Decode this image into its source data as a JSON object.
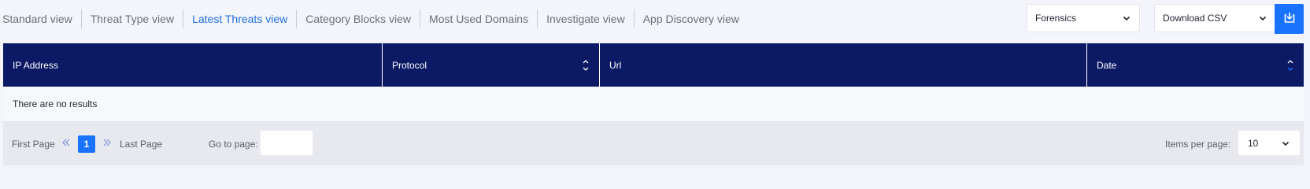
{
  "tabs": [
    {
      "label": "Standard view",
      "active": false
    },
    {
      "label": "Threat Type view",
      "active": false
    },
    {
      "label": "Latest Threats view",
      "active": true
    },
    {
      "label": "Category Blocks view",
      "active": false
    },
    {
      "label": "Most Used Domains",
      "active": false
    },
    {
      "label": "Investigate view",
      "active": false
    },
    {
      "label": "App Discovery view",
      "active": false
    }
  ],
  "toolbar": {
    "mode_select": "Forensics",
    "download_select": "Download CSV",
    "download_icon": "download-tray-icon"
  },
  "table": {
    "columns": [
      {
        "label": "IP Address"
      },
      {
        "label": "Protocol"
      },
      {
        "label": "Url"
      },
      {
        "label": "Date"
      }
    ],
    "empty_message": "There are no results"
  },
  "pagination": {
    "first_label": "First Page",
    "current_page": "1",
    "last_label": "Last Page",
    "goto_label": "Go to page:",
    "goto_value": "",
    "items_per_page_label": "Items per page:",
    "items_per_page": "10"
  },
  "colors": {
    "accent": "#1a73ff",
    "header_bg": "#0c1a66",
    "active_tab": "#1f6fe0"
  }
}
